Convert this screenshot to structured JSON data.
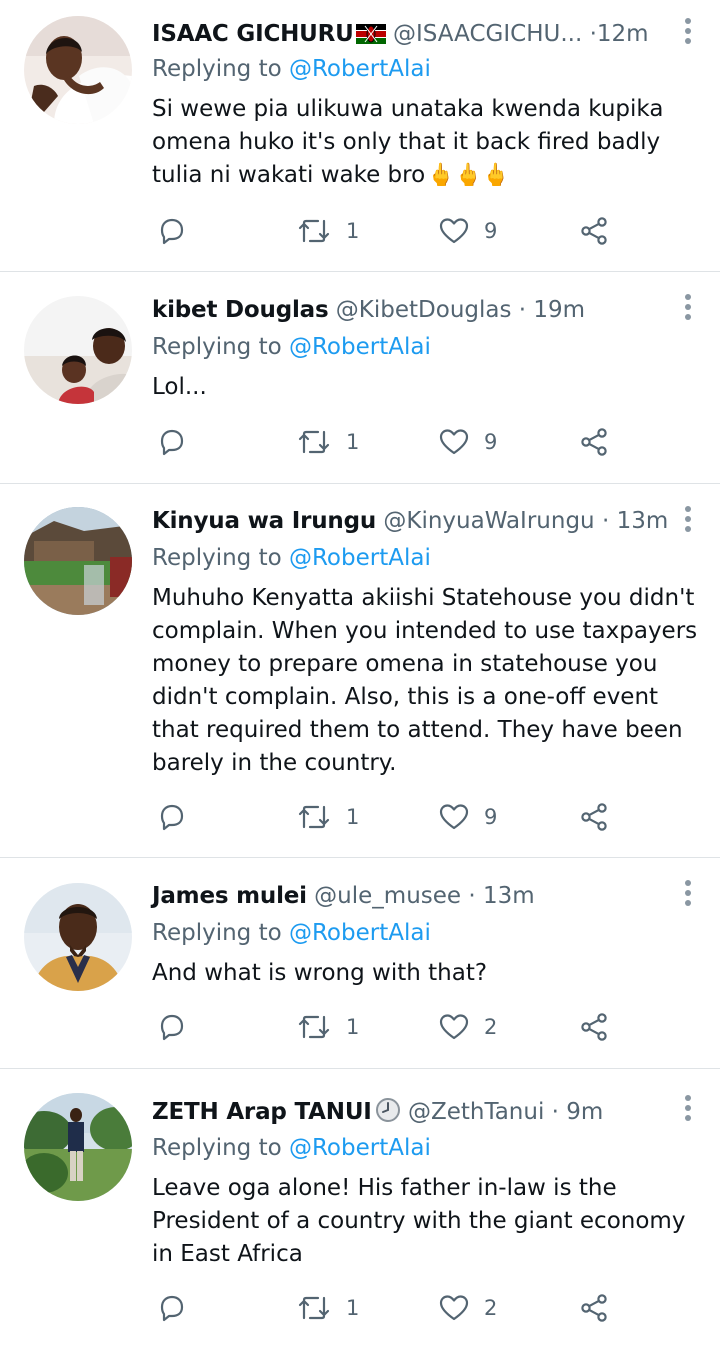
{
  "replying_label": "Replying to",
  "tweets": [
    {
      "name": "ISAAC GICHURU",
      "handle": "@ISAACGICHU...",
      "sep": "·",
      "time": "12m",
      "mention": "@RobertAlai",
      "text": "Si wewe pia ulikuwa unataka kwenda kupika omena huko it's only that it back fired badly tulia ni wakati wake bro",
      "emoji": "🖕🖕🖕",
      "reply_count": "",
      "retweets": "1",
      "likes": "9"
    },
    {
      "name": "kibet Douglas",
      "handle": "@KibetDouglas",
      "sep": "·",
      "time": "19m",
      "mention": "@RobertAlai",
      "text": "Lol...",
      "reply_count": "",
      "retweets": "1",
      "likes": "9"
    },
    {
      "name": "Kinyua wa Irungu",
      "handle": "@KinyuaWaIrungu",
      "sep": "·",
      "time": "13m",
      "mention": "@RobertAlai",
      "text": "Muhuho Kenyatta akiishi Statehouse you didn't complain. When you intended to use taxpayers money to prepare omena in statehouse you didn't complain. Also, this is a one-off event that required them to attend. They have been barely in the country.",
      "reply_count": "",
      "retweets": "1",
      "likes": "9"
    },
    {
      "name": "James mulei",
      "handle": "@ule_musee",
      "sep": "·",
      "time": "13m",
      "mention": "@RobertAlai",
      "text": "And what is wrong with that?",
      "reply_count": "",
      "retweets": "1",
      "likes": "2"
    },
    {
      "name": "ZETH Arap TANUI",
      "handle": "@ZethTanui",
      "sep": "·",
      "time": "9m",
      "mention": "@RobertAlai",
      "text": "Leave oga alone! His father in-law is the President of a country with the giant economy in East Africa",
      "reply_count": "",
      "retweets": "1",
      "likes": "2"
    }
  ],
  "icons": {
    "reply": "reply-icon",
    "retweet": "retweet-icon",
    "like": "heart-icon",
    "share": "share-icon",
    "more": "more-options-icon",
    "flag": "kenya-flag-icon",
    "clock": "clock-icon"
  },
  "colors": {
    "name": "#0f1419",
    "secondary": "#536471",
    "mention": "#1d9bf0",
    "divider": "#dfe3e6",
    "emoji": "#f7b500"
  }
}
